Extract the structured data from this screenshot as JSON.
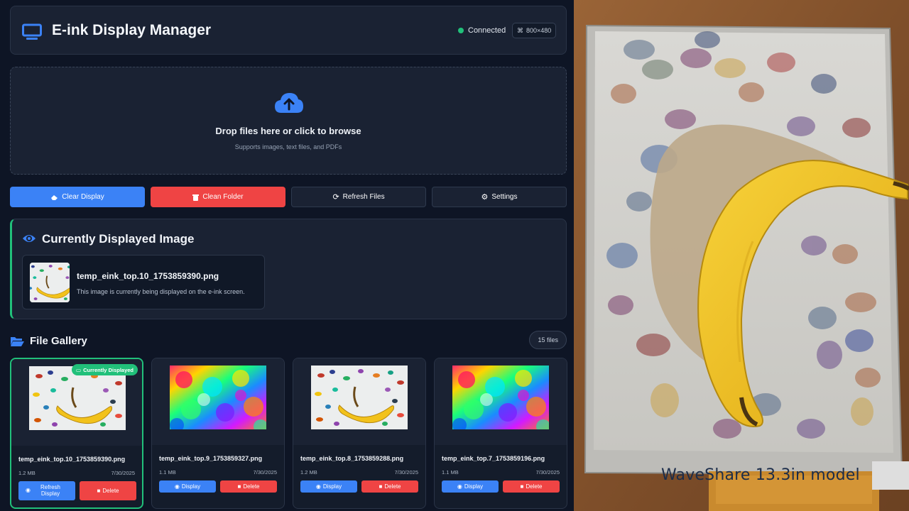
{
  "header": {
    "title": "E-ink Display Manager",
    "status": "Connected",
    "resolution": "800×480",
    "icon": "monitor-icon"
  },
  "dropzone": {
    "title": "Drop files here or click to browse",
    "subtitle": "Supports images, text files, and PDFs",
    "icon": "cloud-upload-icon"
  },
  "actions": {
    "clear": "Clear Display",
    "clean": "Clean Folder",
    "refresh": "Refresh Files",
    "settings": "Settings"
  },
  "current": {
    "title": "Currently Displayed Image",
    "filename": "temp_eink_top.10_1753859390.png",
    "description": "This image is currently being displayed on the e-ink screen."
  },
  "gallery": {
    "title": "File Gallery",
    "count": "15 files",
    "current_badge": "Currently Displayed",
    "items": [
      {
        "name": "temp_eink_top.10_1753859390.png",
        "size": "1.2 MB",
        "date": "7/30/2025",
        "display": "Refresh Display",
        "delete": "Delete"
      },
      {
        "name": "temp_eink_top.9_1753859327.png",
        "size": "1.1 MB",
        "date": "7/30/2025",
        "display": "Display",
        "delete": "Delete"
      },
      {
        "name": "temp_eink_top.8_1753859288.png",
        "size": "1.2 MB",
        "date": "7/30/2025",
        "display": "Display",
        "delete": "Delete"
      },
      {
        "name": "temp_eink_top.7_1753859196.png",
        "size": "1.1 MB",
        "date": "7/30/2025",
        "display": "Display",
        "delete": "Delete"
      }
    ]
  },
  "photo": {
    "caption": "WaveShare 13.3in  model"
  },
  "colors": {
    "accent": "#3b82f6",
    "danger": "#ef4444",
    "success": "#21c07a",
    "background": "#0e1525",
    "panel": "#1a2233"
  }
}
